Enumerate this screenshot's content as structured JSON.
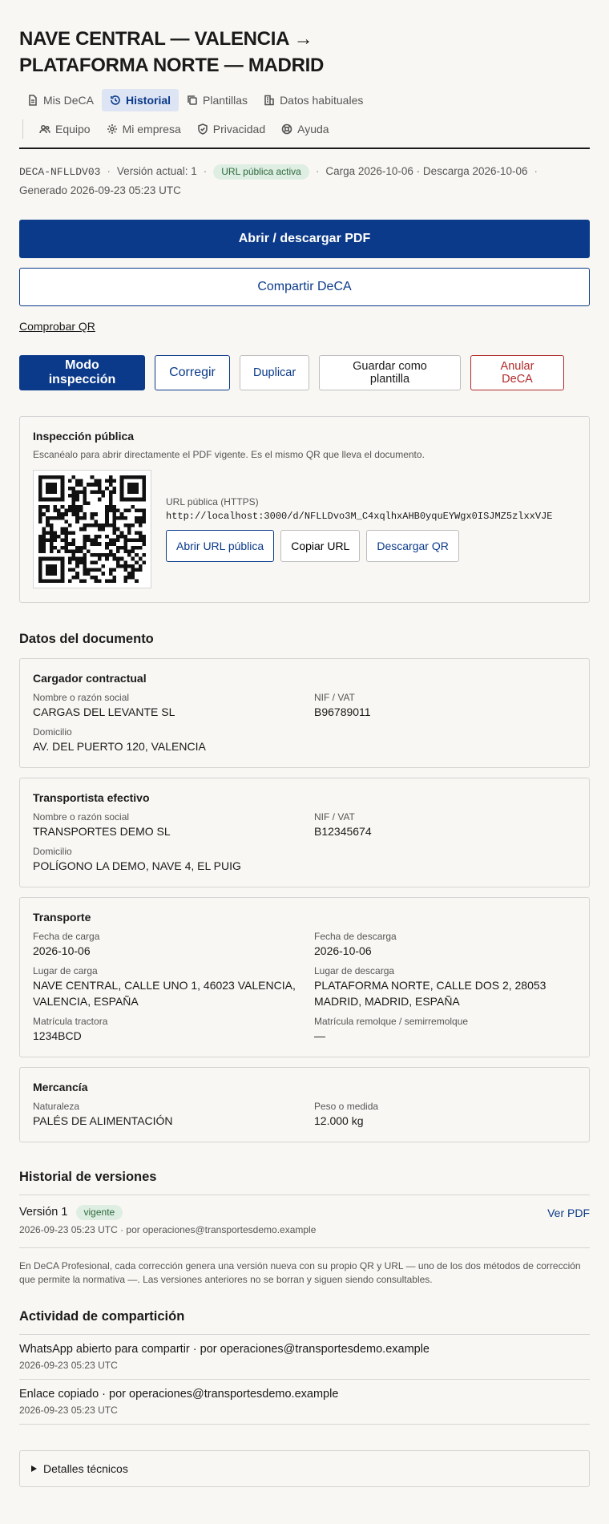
{
  "title": "NAVE CENTRAL — VALENCIA → PLATAFORMA NORTE — MADRID",
  "nav": {
    "row1": [
      {
        "label": "Mis DeCA",
        "icon": "document-icon",
        "active": false
      },
      {
        "label": "Historial",
        "icon": "history-icon",
        "active": true
      },
      {
        "label": "Plantillas",
        "icon": "copy-icon",
        "active": false
      },
      {
        "label": "Datos habituales",
        "icon": "building-icon",
        "active": false
      }
    ],
    "row2": [
      {
        "label": "Equipo",
        "icon": "users-icon"
      },
      {
        "label": "Mi empresa",
        "icon": "gear-icon"
      },
      {
        "label": "Privacidad",
        "icon": "shield-icon"
      },
      {
        "label": "Ayuda",
        "icon": "help-icon"
      }
    ]
  },
  "meta": {
    "code": "DECA-NFLLDV03",
    "version": "Versión actual: 1",
    "badge": "URL pública activa",
    "dates": "Carga 2026-10-06 · Descarga 2026-10-06",
    "generated": "Generado 2026-09-23 05:23 UTC"
  },
  "buttons": {
    "open_pdf": "Abrir / descargar PDF",
    "share": "Compartir DeCA",
    "check_qr": "Comprobar QR",
    "inspection_mode": "Modo inspección",
    "correct": "Corregir",
    "duplicate": "Duplicar",
    "save_template": "Guardar como plantilla",
    "cancel": "Anular DeCA"
  },
  "inspection": {
    "title": "Inspección pública",
    "subtitle": "Escanéalo para abrir directamente el PDF vigente. Es el mismo QR que lleva el documento.",
    "url_label": "URL pública (HTTPS)",
    "url": "http://localhost:3000/d/NFLLDvo3M_C4xqlhxAHB0yquEYWgx0ISJMZ5zlxxVJE",
    "open_url": "Abrir URL pública",
    "copy_url": "Copiar URL",
    "download_qr": "Descargar QR"
  },
  "document": {
    "title": "Datos del documento",
    "shipper": {
      "title": "Cargador contractual",
      "name_label": "Nombre o razón social",
      "name": "CARGAS DEL LEVANTE SL",
      "vat_label": "NIF / VAT",
      "vat": "B96789011",
      "address_label": "Domicilio",
      "address": "AV. DEL PUERTO 120, VALENCIA"
    },
    "carrier": {
      "title": "Transportista efectivo",
      "name_label": "Nombre o razón social",
      "name": "TRANSPORTES DEMO SL",
      "vat_label": "NIF / VAT",
      "vat": "B12345674",
      "address_label": "Domicilio",
      "address": "POLÍGONO LA DEMO, NAVE 4, EL PUIG"
    },
    "transport": {
      "title": "Transporte",
      "load_date_label": "Fecha de carga",
      "load_date": "2026-10-06",
      "unload_date_label": "Fecha de descarga",
      "unload_date": "2026-10-06",
      "load_place_label": "Lugar de carga",
      "load_place": "NAVE CENTRAL, CALLE UNO 1, 46023 VALENCIA, VALENCIA, ESPAÑA",
      "unload_place_label": "Lugar de descarga",
      "unload_place": "PLATAFORMA NORTE, CALLE DOS 2, 28053 MADRID, MADRID, ESPAÑA",
      "tractor_label": "Matrícula tractora",
      "tractor": "1234BCD",
      "trailer_label": "Matrícula remolque / semirremolque",
      "trailer": "—"
    },
    "goods": {
      "title": "Mercancía",
      "nature_label": "Naturaleza",
      "nature": "PALÉS DE ALIMENTACIÓN",
      "weight_label": "Peso o medida",
      "weight": "12.000 kg"
    }
  },
  "history": {
    "title": "Historial de versiones",
    "version": "Versión 1",
    "badge": "vigente",
    "view_pdf": "Ver PDF",
    "meta": "2026-09-23 05:23 UTC · por operaciones@transportesdemo.example",
    "note": "En DeCA Profesional, cada corrección genera una versión nueva con su propio QR y URL — uno de los dos métodos de corrección que permite la normativa —. Las versiones anteriores no se borran y siguen siendo consultables."
  },
  "sharing": {
    "title": "Actividad de compartición",
    "items": [
      {
        "text": "WhatsApp abierto para compartir · por operaciones@transportesdemo.example",
        "time": "2026-09-23 05:23 UTC"
      },
      {
        "text": "Enlace copiado · por operaciones@transportesdemo.example",
        "time": "2026-09-23 05:23 UTC"
      }
    ]
  },
  "details": "Detalles técnicos",
  "colors": {
    "primary": "#0b3a8a",
    "danger": "#b22a2a",
    "badge_bg": "#dfeee2",
    "badge_text": "#2d6a3e",
    "background": "#f8f7f3"
  }
}
